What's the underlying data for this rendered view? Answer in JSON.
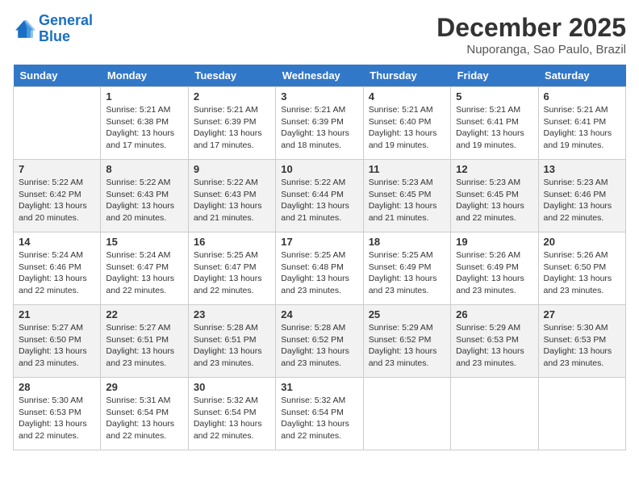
{
  "logo": {
    "line1": "General",
    "line2": "Blue"
  },
  "title": "December 2025",
  "subtitle": "Nuporanga, Sao Paulo, Brazil",
  "weekdays": [
    "Sunday",
    "Monday",
    "Tuesday",
    "Wednesday",
    "Thursday",
    "Friday",
    "Saturday"
  ],
  "weeks": [
    [
      {
        "day": "",
        "sunrise": "",
        "sunset": "",
        "daylight": ""
      },
      {
        "day": "1",
        "sunrise": "Sunrise: 5:21 AM",
        "sunset": "Sunset: 6:38 PM",
        "daylight": "Daylight: 13 hours and 17 minutes."
      },
      {
        "day": "2",
        "sunrise": "Sunrise: 5:21 AM",
        "sunset": "Sunset: 6:39 PM",
        "daylight": "Daylight: 13 hours and 17 minutes."
      },
      {
        "day": "3",
        "sunrise": "Sunrise: 5:21 AM",
        "sunset": "Sunset: 6:39 PM",
        "daylight": "Daylight: 13 hours and 18 minutes."
      },
      {
        "day": "4",
        "sunrise": "Sunrise: 5:21 AM",
        "sunset": "Sunset: 6:40 PM",
        "daylight": "Daylight: 13 hours and 19 minutes."
      },
      {
        "day": "5",
        "sunrise": "Sunrise: 5:21 AM",
        "sunset": "Sunset: 6:41 PM",
        "daylight": "Daylight: 13 hours and 19 minutes."
      },
      {
        "day": "6",
        "sunrise": "Sunrise: 5:21 AM",
        "sunset": "Sunset: 6:41 PM",
        "daylight": "Daylight: 13 hours and 19 minutes."
      }
    ],
    [
      {
        "day": "7",
        "sunrise": "Sunrise: 5:22 AM",
        "sunset": "Sunset: 6:42 PM",
        "daylight": "Daylight: 13 hours and 20 minutes."
      },
      {
        "day": "8",
        "sunrise": "Sunrise: 5:22 AM",
        "sunset": "Sunset: 6:43 PM",
        "daylight": "Daylight: 13 hours and 20 minutes."
      },
      {
        "day": "9",
        "sunrise": "Sunrise: 5:22 AM",
        "sunset": "Sunset: 6:43 PM",
        "daylight": "Daylight: 13 hours and 21 minutes."
      },
      {
        "day": "10",
        "sunrise": "Sunrise: 5:22 AM",
        "sunset": "Sunset: 6:44 PM",
        "daylight": "Daylight: 13 hours and 21 minutes."
      },
      {
        "day": "11",
        "sunrise": "Sunrise: 5:23 AM",
        "sunset": "Sunset: 6:45 PM",
        "daylight": "Daylight: 13 hours and 21 minutes."
      },
      {
        "day": "12",
        "sunrise": "Sunrise: 5:23 AM",
        "sunset": "Sunset: 6:45 PM",
        "daylight": "Daylight: 13 hours and 22 minutes."
      },
      {
        "day": "13",
        "sunrise": "Sunrise: 5:23 AM",
        "sunset": "Sunset: 6:46 PM",
        "daylight": "Daylight: 13 hours and 22 minutes."
      }
    ],
    [
      {
        "day": "14",
        "sunrise": "Sunrise: 5:24 AM",
        "sunset": "Sunset: 6:46 PM",
        "daylight": "Daylight: 13 hours and 22 minutes."
      },
      {
        "day": "15",
        "sunrise": "Sunrise: 5:24 AM",
        "sunset": "Sunset: 6:47 PM",
        "daylight": "Daylight: 13 hours and 22 minutes."
      },
      {
        "day": "16",
        "sunrise": "Sunrise: 5:25 AM",
        "sunset": "Sunset: 6:47 PM",
        "daylight": "Daylight: 13 hours and 22 minutes."
      },
      {
        "day": "17",
        "sunrise": "Sunrise: 5:25 AM",
        "sunset": "Sunset: 6:48 PM",
        "daylight": "Daylight: 13 hours and 23 minutes."
      },
      {
        "day": "18",
        "sunrise": "Sunrise: 5:25 AM",
        "sunset": "Sunset: 6:49 PM",
        "daylight": "Daylight: 13 hours and 23 minutes."
      },
      {
        "day": "19",
        "sunrise": "Sunrise: 5:26 AM",
        "sunset": "Sunset: 6:49 PM",
        "daylight": "Daylight: 13 hours and 23 minutes."
      },
      {
        "day": "20",
        "sunrise": "Sunrise: 5:26 AM",
        "sunset": "Sunset: 6:50 PM",
        "daylight": "Daylight: 13 hours and 23 minutes."
      }
    ],
    [
      {
        "day": "21",
        "sunrise": "Sunrise: 5:27 AM",
        "sunset": "Sunset: 6:50 PM",
        "daylight": "Daylight: 13 hours and 23 minutes."
      },
      {
        "day": "22",
        "sunrise": "Sunrise: 5:27 AM",
        "sunset": "Sunset: 6:51 PM",
        "daylight": "Daylight: 13 hours and 23 minutes."
      },
      {
        "day": "23",
        "sunrise": "Sunrise: 5:28 AM",
        "sunset": "Sunset: 6:51 PM",
        "daylight": "Daylight: 13 hours and 23 minutes."
      },
      {
        "day": "24",
        "sunrise": "Sunrise: 5:28 AM",
        "sunset": "Sunset: 6:52 PM",
        "daylight": "Daylight: 13 hours and 23 minutes."
      },
      {
        "day": "25",
        "sunrise": "Sunrise: 5:29 AM",
        "sunset": "Sunset: 6:52 PM",
        "daylight": "Daylight: 13 hours and 23 minutes."
      },
      {
        "day": "26",
        "sunrise": "Sunrise: 5:29 AM",
        "sunset": "Sunset: 6:53 PM",
        "daylight": "Daylight: 13 hours and 23 minutes."
      },
      {
        "day": "27",
        "sunrise": "Sunrise: 5:30 AM",
        "sunset": "Sunset: 6:53 PM",
        "daylight": "Daylight: 13 hours and 23 minutes."
      }
    ],
    [
      {
        "day": "28",
        "sunrise": "Sunrise: 5:30 AM",
        "sunset": "Sunset: 6:53 PM",
        "daylight": "Daylight: 13 hours and 22 minutes."
      },
      {
        "day": "29",
        "sunrise": "Sunrise: 5:31 AM",
        "sunset": "Sunset: 6:54 PM",
        "daylight": "Daylight: 13 hours and 22 minutes."
      },
      {
        "day": "30",
        "sunrise": "Sunrise: 5:32 AM",
        "sunset": "Sunset: 6:54 PM",
        "daylight": "Daylight: 13 hours and 22 minutes."
      },
      {
        "day": "31",
        "sunrise": "Sunrise: 5:32 AM",
        "sunset": "Sunset: 6:54 PM",
        "daylight": "Daylight: 13 hours and 22 minutes."
      },
      {
        "day": "",
        "sunrise": "",
        "sunset": "",
        "daylight": ""
      },
      {
        "day": "",
        "sunrise": "",
        "sunset": "",
        "daylight": ""
      },
      {
        "day": "",
        "sunrise": "",
        "sunset": "",
        "daylight": ""
      }
    ]
  ]
}
